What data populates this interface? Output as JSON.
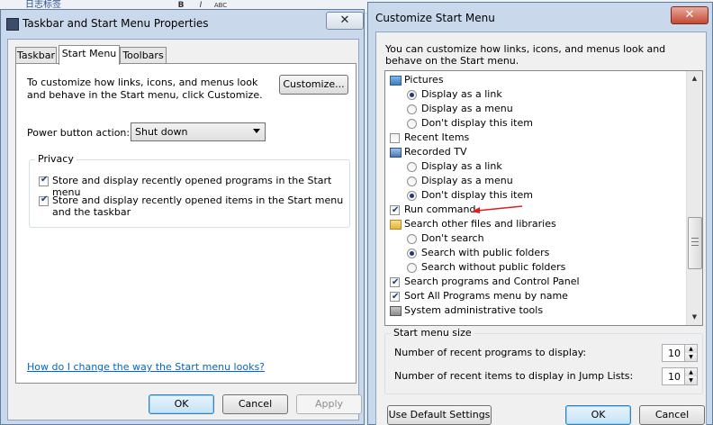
{
  "background_app": {
    "text": "日志标签",
    "toolbar": [
      "B",
      "I",
      "ABC"
    ]
  },
  "window1": {
    "title": "Taskbar and Start Menu Properties",
    "close_glyph": "✕",
    "tabs": [
      "Taskbar",
      "Start Menu",
      "Toolbars"
    ],
    "active_tab": "Start Menu",
    "intro": "To customize how links, icons, and menus look and behave in the Start menu, click Customize.",
    "customize_button": "Customize...",
    "power_label": "Power button action:",
    "power_value": "Shut down",
    "privacy": {
      "legend": "Privacy",
      "items": [
        {
          "label": "Store and display recently opened programs in the Start menu",
          "checked": true
        },
        {
          "label": "Store and display recently opened items in the Start menu and the taskbar",
          "checked": true
        }
      ]
    },
    "help_link": "How do I change the way the Start menu looks?",
    "ok": "OK",
    "cancel": "Cancel",
    "apply": "Apply"
  },
  "window2": {
    "title": "Customize Start Menu",
    "close_glyph": "✕",
    "intro": "You can customize how links, icons, and menus look and behave on the Start menu.",
    "list": [
      {
        "kind": "header",
        "icon": "pictures-icon",
        "label": "Pictures"
      },
      {
        "kind": "radio",
        "label": "Display as a link",
        "checked": true
      },
      {
        "kind": "radio",
        "label": "Display as a menu",
        "checked": false
      },
      {
        "kind": "radio",
        "label": "Don't display this item",
        "checked": false
      },
      {
        "kind": "checkbox",
        "label": "Recent Items",
        "checked": false
      },
      {
        "kind": "header",
        "icon": "recorded-tv-icon",
        "label": "Recorded TV"
      },
      {
        "kind": "radio",
        "label": "Display as a link",
        "checked": false
      },
      {
        "kind": "radio",
        "label": "Display as a menu",
        "checked": false
      },
      {
        "kind": "radio",
        "label": "Don't display this item",
        "checked": true
      },
      {
        "kind": "checkbox",
        "label": "Run command",
        "checked": true
      },
      {
        "kind": "header",
        "icon": "folder-icon",
        "label": "Search other files and libraries"
      },
      {
        "kind": "radio",
        "label": "Don't search",
        "checked": false
      },
      {
        "kind": "radio",
        "label": "Search with public folders",
        "checked": true
      },
      {
        "kind": "radio",
        "label": "Search without public folders",
        "checked": false
      },
      {
        "kind": "checkbox",
        "label": "Search programs and Control Panel",
        "checked": true
      },
      {
        "kind": "checkbox",
        "label": "Sort All Programs menu by name",
        "checked": true
      },
      {
        "kind": "header",
        "icon": "admin-tools-icon",
        "label": "System administrative tools"
      }
    ],
    "size_group": {
      "legend": "Start menu size",
      "recent_programs_label": "Number of recent programs to display:",
      "recent_programs_value": "10",
      "recent_items_label": "Number of recent items to display in Jump Lists:",
      "recent_items_value": "10"
    },
    "default_button": "Use Default Settings",
    "ok": "OK",
    "cancel": "Cancel"
  },
  "annotation_color": "#e02020"
}
